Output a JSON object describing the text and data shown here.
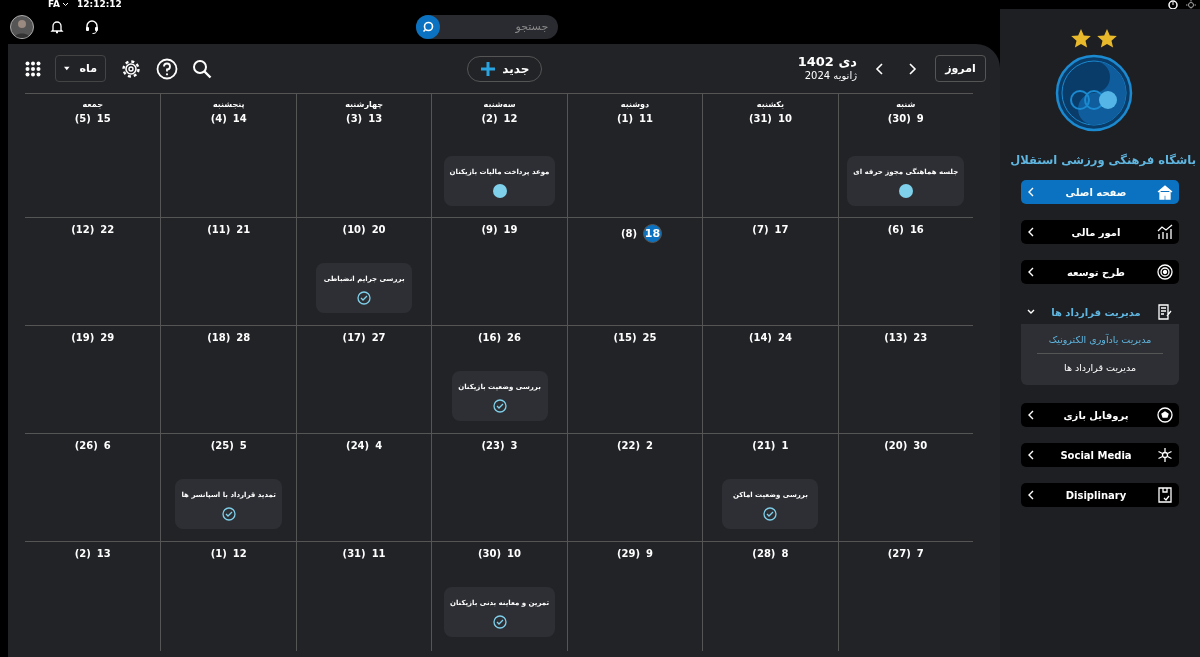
{
  "status_bar": {
    "language": "FA",
    "time": "12:12:12"
  },
  "header": {
    "search": {
      "placeholder": "جستجو"
    }
  },
  "toolbar": {
    "today_button": "امروز",
    "title": "دی 1402",
    "subtitle": "ژانویه 2024",
    "new_button": "جدید",
    "view_select": "ماه"
  },
  "calendar": {
    "weekdays": [
      "شنبه",
      "یکشنبه",
      "دوشنبه",
      "سه‌شنبه",
      "چهارشنبه",
      "پنجشنبه",
      "جمعه"
    ],
    "weeks": [
      [
        {
          "day": "9",
          "alt": "(30)",
          "today": false,
          "events": [
            {
              "title": "جلسه هماهنگی مجوز حرفه ای",
              "kind": "dot",
              "color": "#7fd0ea"
            }
          ]
        },
        {
          "day": "10",
          "alt": "(31)",
          "today": false
        },
        {
          "day": "11",
          "alt": "(1)",
          "today": false
        },
        {
          "day": "12",
          "alt": "(2)",
          "today": false,
          "events": [
            {
              "title": "موعد پرداخت مالیات بازیکنان",
              "kind": "dot",
              "color": "#7fd0ea"
            }
          ]
        },
        {
          "day": "13",
          "alt": "(3)",
          "today": false
        },
        {
          "day": "14",
          "alt": "(4)",
          "today": false
        },
        {
          "day": "15",
          "alt": "(5)",
          "today": false
        }
      ],
      [
        {
          "day": "16",
          "alt": "(6)",
          "today": false
        },
        {
          "day": "17",
          "alt": "(7)",
          "today": false
        },
        {
          "day": "18",
          "alt": "(8)",
          "today": true
        },
        {
          "day": "19",
          "alt": "(9)",
          "today": false
        },
        {
          "day": "20",
          "alt": "(10)",
          "today": false,
          "events": [
            {
              "title": "بررسی جرایم انضباطی",
              "kind": "check"
            }
          ]
        },
        {
          "day": "21",
          "alt": "(11)",
          "today": false
        },
        {
          "day": "22",
          "alt": "(12)",
          "today": false
        }
      ],
      [
        {
          "day": "23",
          "alt": "(13)",
          "today": false
        },
        {
          "day": "24",
          "alt": "(14)",
          "today": false
        },
        {
          "day": "25",
          "alt": "(15)",
          "today": false
        },
        {
          "day": "26",
          "alt": "(16)",
          "today": false,
          "events": [
            {
              "title": "بررسی وضعیت بازیکنان",
              "kind": "check"
            }
          ]
        },
        {
          "day": "27",
          "alt": "(17)",
          "today": false
        },
        {
          "day": "28",
          "alt": "(18)",
          "today": false
        },
        {
          "day": "29",
          "alt": "(19)",
          "today": false
        }
      ],
      [
        {
          "day": "30",
          "alt": "(20)",
          "today": false
        },
        {
          "day": "1",
          "alt": "(21)",
          "today": false,
          "events": [
            {
              "title": "بررسی وضعیت اماکن",
              "kind": "check"
            }
          ]
        },
        {
          "day": "2",
          "alt": "(22)",
          "today": false
        },
        {
          "day": "3",
          "alt": "(23)",
          "today": false
        },
        {
          "day": "4",
          "alt": "(24)",
          "today": false
        },
        {
          "day": "5",
          "alt": "(25)",
          "today": false,
          "events": [
            {
              "title": "تمدید قرارداد با اسپانسر ها",
              "kind": "check"
            }
          ]
        },
        {
          "day": "6",
          "alt": "(26)",
          "today": false
        }
      ],
      [
        {
          "day": "7",
          "alt": "(27)",
          "today": false
        },
        {
          "day": "8",
          "alt": "(28)",
          "today": false
        },
        {
          "day": "9",
          "alt": "(29)",
          "today": false
        },
        {
          "day": "10",
          "alt": "(30)",
          "today": false,
          "events": [
            {
              "title": "تمرین و معاینه بدنی بازیکنان",
              "kind": "check"
            }
          ]
        },
        {
          "day": "11",
          "alt": "(31)",
          "today": false
        },
        {
          "day": "12",
          "alt": "(1)",
          "today": false
        },
        {
          "day": "13",
          "alt": "(2)",
          "today": false
        }
      ]
    ]
  },
  "sidebar": {
    "club_name": "باشگاه فرهنگی ورزشی استقلال",
    "items": [
      {
        "label": "صفحه اصلی",
        "selected": true,
        "expanded": false
      },
      {
        "label": "امور مالی",
        "selected": false,
        "expanded": false
      },
      {
        "label": "طرح توسعه",
        "selected": false,
        "expanded": false
      },
      {
        "label": "مدیریت قرارداد ها",
        "selected": false,
        "expanded": true,
        "children": [
          {
            "label": "مدیریت یادآوری الکترونیک",
            "selected": true
          },
          {
            "label": "مدیریت قرارداد ها",
            "selected": false
          }
        ]
      },
      {
        "label": "پروفایل بازی",
        "selected": false,
        "expanded": false
      },
      {
        "label": "Social Media",
        "selected": false,
        "expanded": false
      },
      {
        "label": "Disiplinary",
        "selected": false,
        "expanded": false
      }
    ]
  }
}
